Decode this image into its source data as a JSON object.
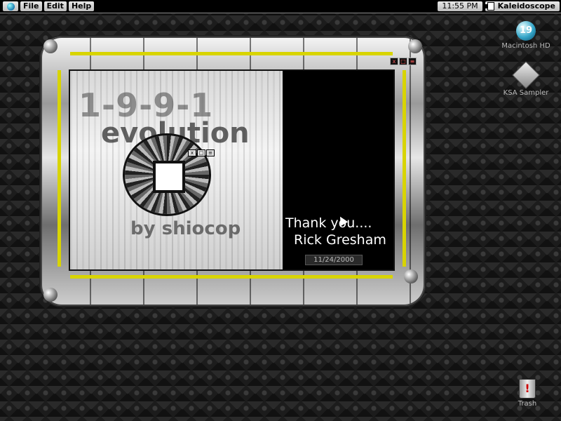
{
  "menubar": {
    "items": [
      "File",
      "Edit",
      "Help"
    ],
    "clock": "11:55 PM",
    "app": "Kaleidoscope"
  },
  "desktop": {
    "icons": [
      {
        "label": "Macintosh HD",
        "icon": "hard-disk-icon",
        "glyph": "19"
      },
      {
        "label": "KSA Sampler",
        "icon": "ksa-sampler-icon"
      },
      {
        "label": "Trash",
        "icon": "trash-icon",
        "glyph": "!"
      }
    ]
  },
  "splash": {
    "title": "1-9-9-1",
    "subtitle": "evolution",
    "author": "by shiocop",
    "thanks_line1": "Thank you....",
    "thanks_line2": "Rick Gresham",
    "date": "11/24/2000"
  },
  "window_controls": [
    "x",
    "□",
    "≡"
  ],
  "colors": {
    "accent_yellow": "#d8d400",
    "menubar_bg": "#000000",
    "desktop_bg": "#1c1c1c"
  }
}
